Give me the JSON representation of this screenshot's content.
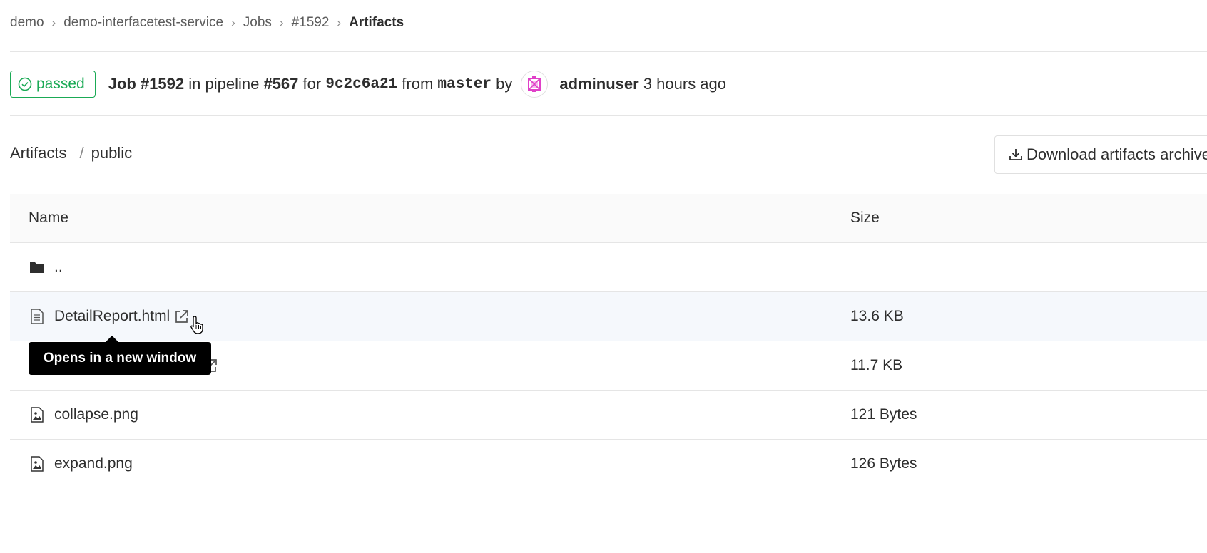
{
  "breadcrumb": [
    "demo",
    "demo-interfacetest-service",
    "Jobs",
    "#1592",
    "Artifacts"
  ],
  "job": {
    "status": "passed",
    "job_label": "Job #1592",
    "in_pipeline": "in pipeline",
    "pipeline": "#567",
    "for": "for",
    "commit": "9c2c6a21",
    "from": "from",
    "branch": "master",
    "by": "by",
    "user": "adminuser",
    "time": "3 hours ago"
  },
  "artifacts": {
    "root": "Artifacts",
    "separator": "/",
    "folder": "public",
    "download_label": "Download artifacts archive"
  },
  "table": {
    "headers": {
      "name": "Name",
      "size": "Size"
    },
    "rows": [
      {
        "name": "..",
        "size": "",
        "icon": "folder-icon"
      },
      {
        "name": "DetailReport.html",
        "size": "13.6 KB",
        "icon": "file-text-icon"
      },
      {
        "name": "",
        "size": "11.7 KB",
        "icon": "file-text-icon"
      },
      {
        "name": "collapse.png",
        "size": "121 Bytes",
        "icon": "file-image-icon"
      },
      {
        "name": "expand.png",
        "size": "126 Bytes",
        "icon": "file-image-icon"
      }
    ]
  },
  "tooltip": "Opens in a new window",
  "colors": {
    "success": "#1aaa55",
    "text": "#2e2e2e",
    "border": "#e5e5e5"
  }
}
